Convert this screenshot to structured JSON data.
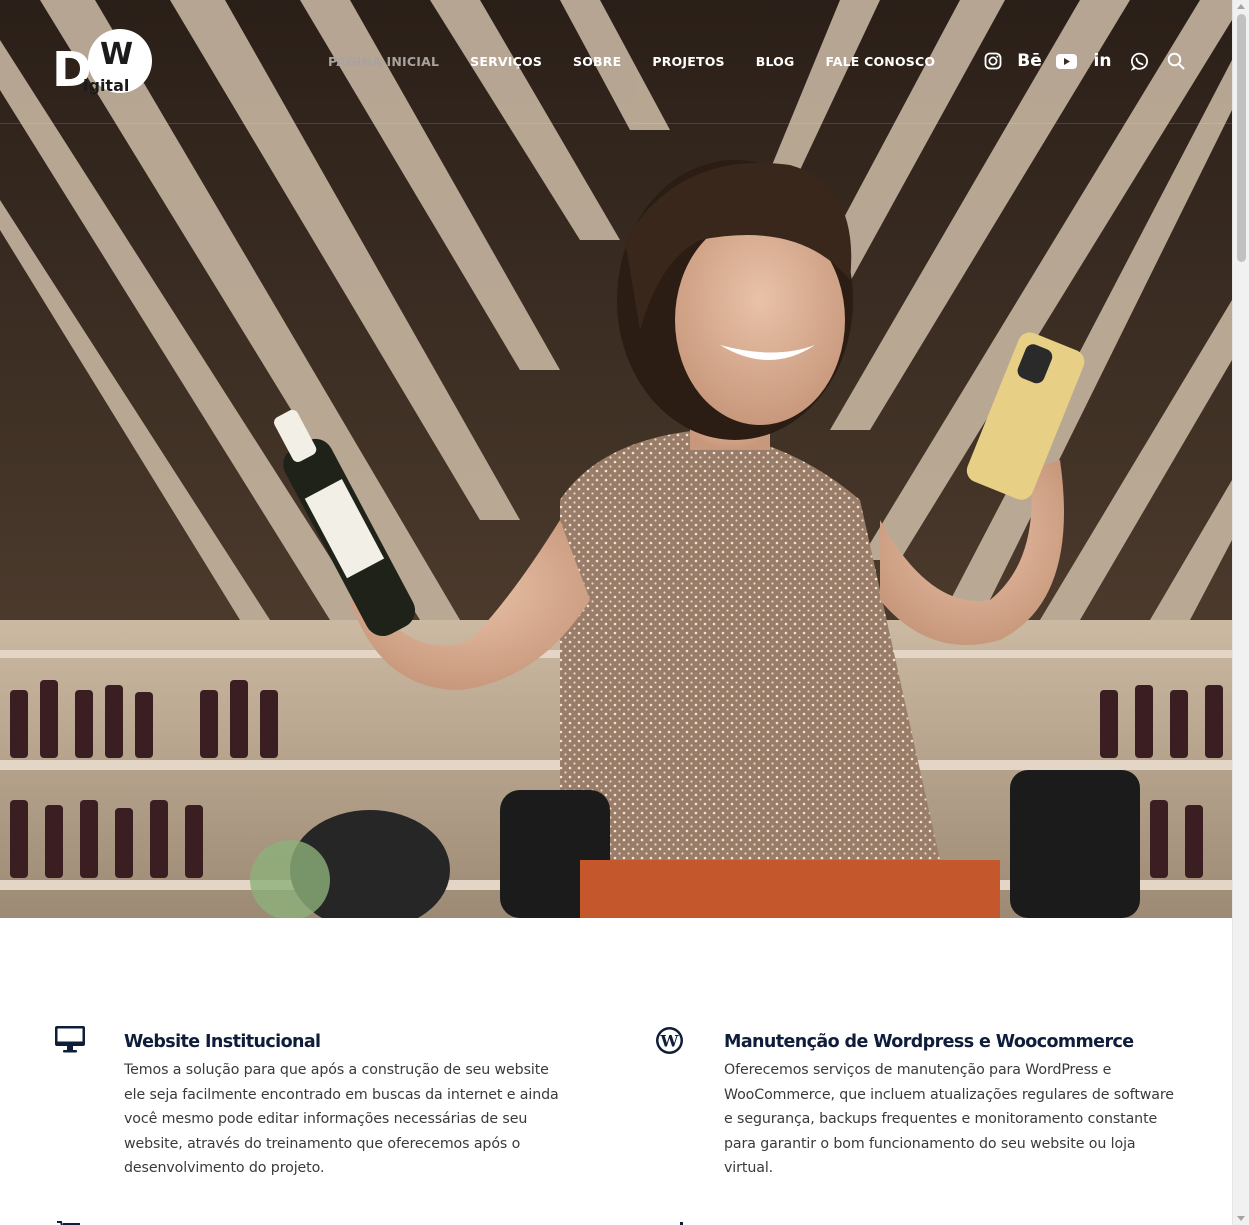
{
  "brand": {
    "logo_big": "D",
    "logo_small_w": "W",
    "logo_small": "igital",
    "logo_dot": "!"
  },
  "nav": {
    "items": [
      {
        "label": "PÁGINA INICIAL",
        "active": true
      },
      {
        "label": "SERVIÇOS",
        "active": false
      },
      {
        "label": "SOBRE",
        "active": false
      },
      {
        "label": "PROJETOS",
        "active": false
      },
      {
        "label": "BLOG",
        "active": false
      },
      {
        "label": "FALE CONOSCO",
        "active": false
      }
    ]
  },
  "social": {
    "icons": [
      "instagram-icon",
      "behance-icon",
      "youtube-icon",
      "linkedin-icon",
      "whatsapp-icon",
      "search-icon"
    ],
    "behance_text": "Bē",
    "linkedin_text": "in"
  },
  "services": [
    {
      "icon": "monitor-icon",
      "title": "Website Institucional",
      "lines": [
        "Temos a solução para que após a construção de seu website",
        "ele seja facilmente encontrado em buscas da internet e ainda",
        "você mesmo pode editar informações necessárias de seu",
        "website, através do treinamento que oferecemos após o",
        "desenvolvimento do projeto."
      ]
    },
    {
      "icon": "wordpress-icon",
      "title": "Manutenção de Wordpress e Woocommerce",
      "lines": [
        "Oferecemos serviços de manutenção para WordPress e",
        "WooCommerce, que incluem atualizações regulares de software",
        "e segurança, backups frequentes e monitoramento constante",
        "para garantir o bom funcionamento do seu website ou loja",
        "virtual."
      ]
    }
  ],
  "colors": {
    "navy": "#0f1d3a",
    "nav_active": "#a9a39f",
    "body_text": "#3a3a3a"
  }
}
